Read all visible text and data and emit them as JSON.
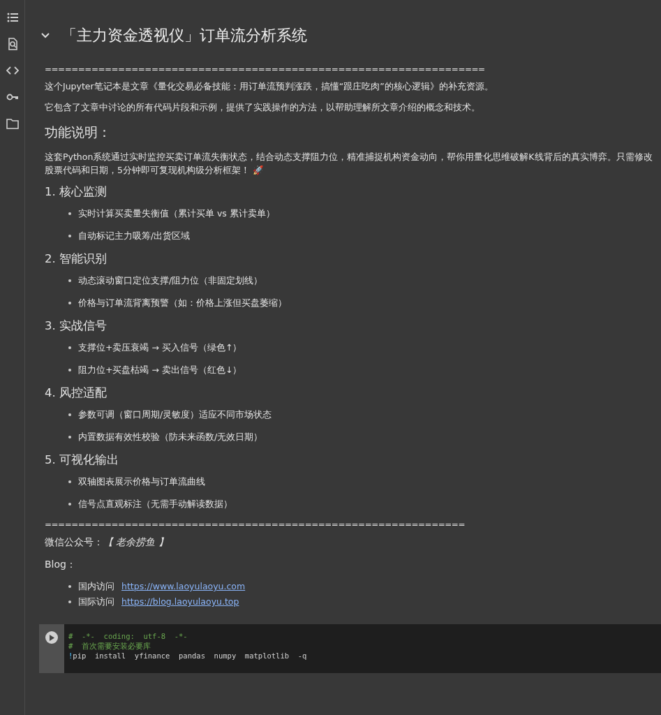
{
  "sidebar": {
    "items": [
      {
        "kind": "toc"
      },
      {
        "kind": "find"
      },
      {
        "kind": "code"
      },
      {
        "kind": "secrets"
      },
      {
        "kind": "files"
      }
    ]
  },
  "markdown_cell": {
    "heading": "「主力资金透视仪」订单流分析系统",
    "expanded": true,
    "rule_top": "==================================================================",
    "intro": [
      "这个Jupyter笔记本是文章《量化交易必备技能：用订单流预判涨跌，搞懂“跟庄吃肉”的核心逻辑》的补充资源。",
      "它包含了文章中讨论的所有代码片段和示例，提供了实践操作的方法，以帮助理解所文章介绍的概念和技术。"
    ],
    "section_title": "功能说明：",
    "description": "这套Python系统通过实时监控买卖订单流失衡状态，结合动态支撑阻力位，精准捕捉机构资金动向，帮你用量化思维破解K线背后的真实博弈。只需修改股票代码和日期，5分钟即可复现机构级分析框架！ 🚀",
    "features": [
      {
        "title": "1. 核心监测",
        "items": [
          "实时计算买卖量失衡值（累计买单 vs 累计卖单）",
          "自动标记主力吸筹/出货区域"
        ]
      },
      {
        "title": "2. 智能识别",
        "items": [
          "动态滚动窗口定位支撑/阻力位（非固定划线）",
          "价格与订单流背离预警（如：价格上涨但买盘萎缩）"
        ]
      },
      {
        "title": "3. 实战信号",
        "items": [
          "支撑位+卖压衰竭 → 买入信号（绿色↑）",
          "阻力位+买盘枯竭 → 卖出信号（红色↓）"
        ]
      },
      {
        "title": "4. 风控适配",
        "items": [
          "参数可调（窗口周期/灵敏度）适应不同市场状态",
          "内置数据有效性校验（防未来函数/无效日期）"
        ]
      },
      {
        "title": "5. 可视化输出",
        "items": [
          "双轴图表展示价格与订单流曲线",
          "信号点直观标注（无需手动解读数据）"
        ]
      }
    ],
    "rule_bottom": "===============================================================",
    "wechat": "微信公众号：*【 老余捞鱼 】*",
    "blog_label": "Blog：",
    "links": [
      {
        "label": "国内访问",
        "url": "https://www.laoyulaoyu.com"
      },
      {
        "label": "国际访问",
        "url": "https://blog.laoyulaoyu.top"
      }
    ]
  },
  "code_cell": {
    "lines": [
      {
        "kind": "comment",
        "text": "#  -*-  coding:  utf-8  -*-"
      },
      {
        "kind": "comment",
        "text": "#  首次需要安装必要库"
      },
      {
        "kind": "shell",
        "bang": "!",
        "text": "pip  install  yfinance  pandas  numpy  matplotlib  -q"
      }
    ]
  }
}
